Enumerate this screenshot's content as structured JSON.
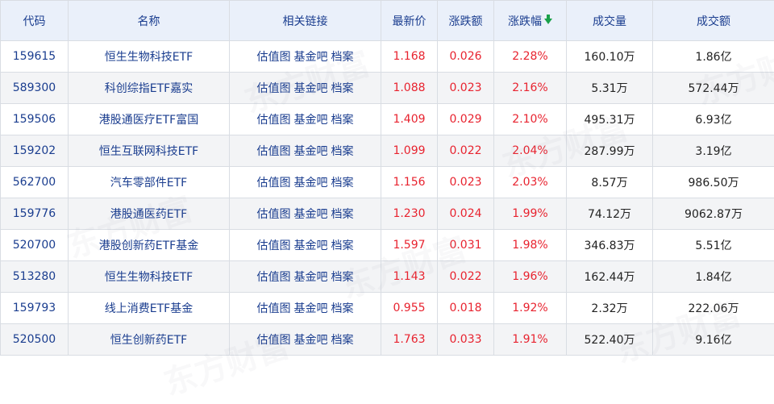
{
  "columns": {
    "code": "代码",
    "name": "名称",
    "links": "相关链接",
    "price": "最新价",
    "change": "涨跌额",
    "pct": "涨跌幅",
    "volume": "成交量",
    "amount": "成交额"
  },
  "sort": {
    "column": "pct",
    "direction": "desc",
    "arrow_color": "#1aa14a"
  },
  "colors": {
    "up": "#e8232f",
    "link": "#1a3d8f",
    "header_bg": "#eaf0fa"
  },
  "watermark": "东方财富",
  "rows": [
    {
      "code": "159615",
      "name": "恒生生物科技ETF",
      "links": [
        "估值图",
        "基金吧",
        "档案"
      ],
      "price": "1.168",
      "change": "0.026",
      "pct": "2.28%",
      "volume": "160.10万",
      "amount": "1.86亿"
    },
    {
      "code": "589300",
      "name": "科创综指ETF嘉实",
      "links": [
        "估值图",
        "基金吧",
        "档案"
      ],
      "price": "1.088",
      "change": "0.023",
      "pct": "2.16%",
      "volume": "5.31万",
      "amount": "572.44万"
    },
    {
      "code": "159506",
      "name": "港股通医疗ETF富国",
      "links": [
        "估值图",
        "基金吧",
        "档案"
      ],
      "price": "1.409",
      "change": "0.029",
      "pct": "2.10%",
      "volume": "495.31万",
      "amount": "6.93亿"
    },
    {
      "code": "159202",
      "name": "恒生互联网科技ETF",
      "links": [
        "估值图",
        "基金吧",
        "档案"
      ],
      "price": "1.099",
      "change": "0.022",
      "pct": "2.04%",
      "volume": "287.99万",
      "amount": "3.19亿"
    },
    {
      "code": "562700",
      "name": "汽车零部件ETF",
      "links": [
        "估值图",
        "基金吧",
        "档案"
      ],
      "price": "1.156",
      "change": "0.023",
      "pct": "2.03%",
      "volume": "8.57万",
      "amount": "986.50万"
    },
    {
      "code": "159776",
      "name": "港股通医药ETF",
      "links": [
        "估值图",
        "基金吧",
        "档案"
      ],
      "price": "1.230",
      "change": "0.024",
      "pct": "1.99%",
      "volume": "74.12万",
      "amount": "9062.87万"
    },
    {
      "code": "520700",
      "name": "港股创新药ETF基金",
      "links": [
        "估值图",
        "基金吧",
        "档案"
      ],
      "price": "1.597",
      "change": "0.031",
      "pct": "1.98%",
      "volume": "346.83万",
      "amount": "5.51亿"
    },
    {
      "code": "513280",
      "name": "恒生生物科技ETF",
      "links": [
        "估值图",
        "基金吧",
        "档案"
      ],
      "price": "1.143",
      "change": "0.022",
      "pct": "1.96%",
      "volume": "162.44万",
      "amount": "1.84亿"
    },
    {
      "code": "159793",
      "name": "线上消费ETF基金",
      "links": [
        "估值图",
        "基金吧",
        "档案"
      ],
      "price": "0.955",
      "change": "0.018",
      "pct": "1.92%",
      "volume": "2.32万",
      "amount": "222.06万"
    },
    {
      "code": "520500",
      "name": "恒生创新药ETF",
      "links": [
        "估值图",
        "基金吧",
        "档案"
      ],
      "price": "1.763",
      "change": "0.033",
      "pct": "1.91%",
      "volume": "522.40万",
      "amount": "9.16亿"
    }
  ]
}
